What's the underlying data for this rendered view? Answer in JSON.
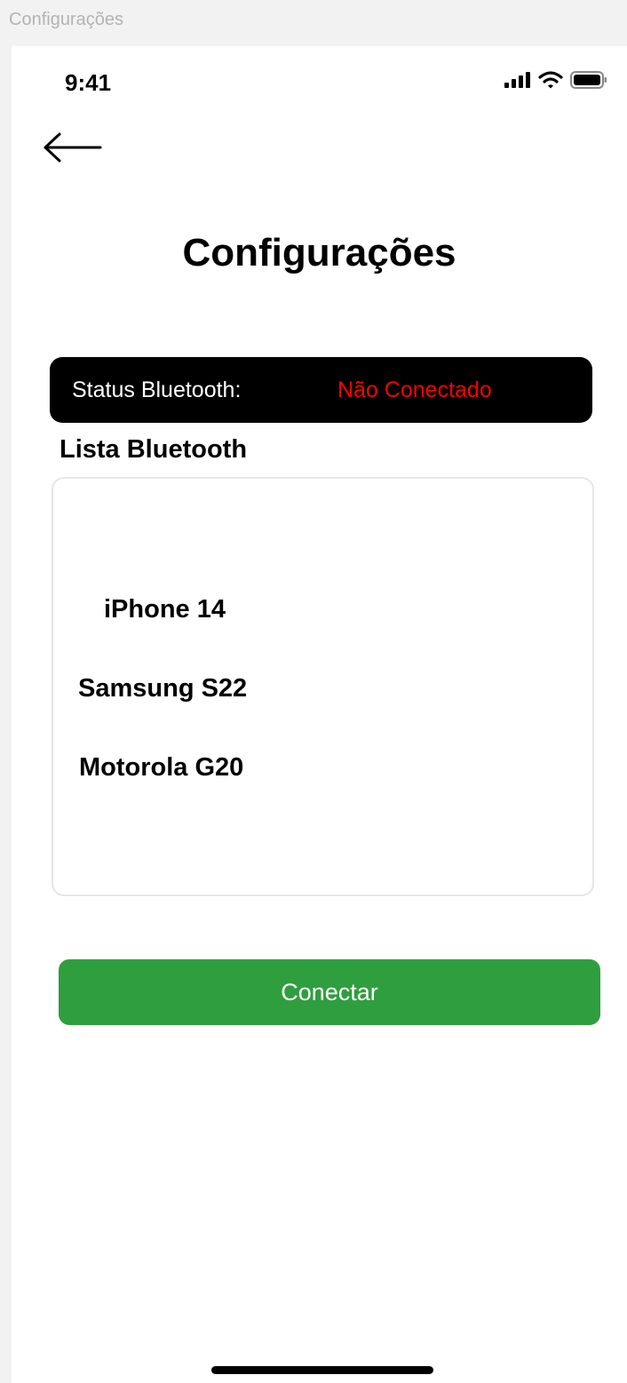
{
  "window": {
    "title": "Configurações"
  },
  "status_bar": {
    "time": "9:41",
    "icons": [
      "signal-icon",
      "wifi-icon",
      "battery-icon"
    ]
  },
  "header": {
    "back_icon": "arrow-left-icon",
    "title": "Configurações"
  },
  "bluetooth_status": {
    "label": "Status Bluetooth:",
    "value": "Não Conectado",
    "value_color": "#ff0000"
  },
  "bluetooth_list": {
    "heading": "Lista Bluetooth",
    "devices": [
      {
        "name": "iPhone 14"
      },
      {
        "name": "Samsung S22"
      },
      {
        "name": "Motorola G20"
      }
    ]
  },
  "actions": {
    "connect_label": "Conectar",
    "connect_color": "#2f9e3f"
  }
}
